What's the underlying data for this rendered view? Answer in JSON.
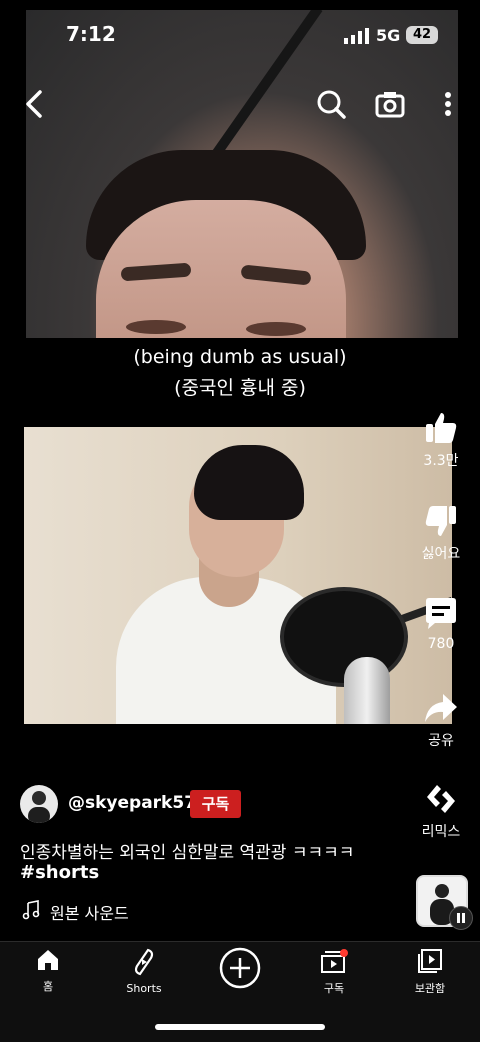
{
  "status_bar": {
    "time": "7:12",
    "network": "5G",
    "battery": "42"
  },
  "captions": {
    "line1": "(being dumb as usual)",
    "line2": "(중국인 흉내 중)"
  },
  "rail": {
    "like_count": "3.3만",
    "dislike_label": "싫어요",
    "comment_count": "780",
    "share_label": "공유",
    "remix_label": "리믹스"
  },
  "channel": {
    "handle": "@skyepark57",
    "subscribe_label": "구독"
  },
  "video": {
    "title": "인종차별하는 외국인 심한말로 역관광 ㅋㅋㅋㅋ",
    "hashtag": "#shorts"
  },
  "sound": {
    "label": "원본 사운드"
  },
  "nav": {
    "home": "홈",
    "shorts": "Shorts",
    "subscriptions": "구독",
    "library": "보관함"
  },
  "colors": {
    "subscribe": "#cc1f1f",
    "notification_dot": "#ff3b30"
  }
}
